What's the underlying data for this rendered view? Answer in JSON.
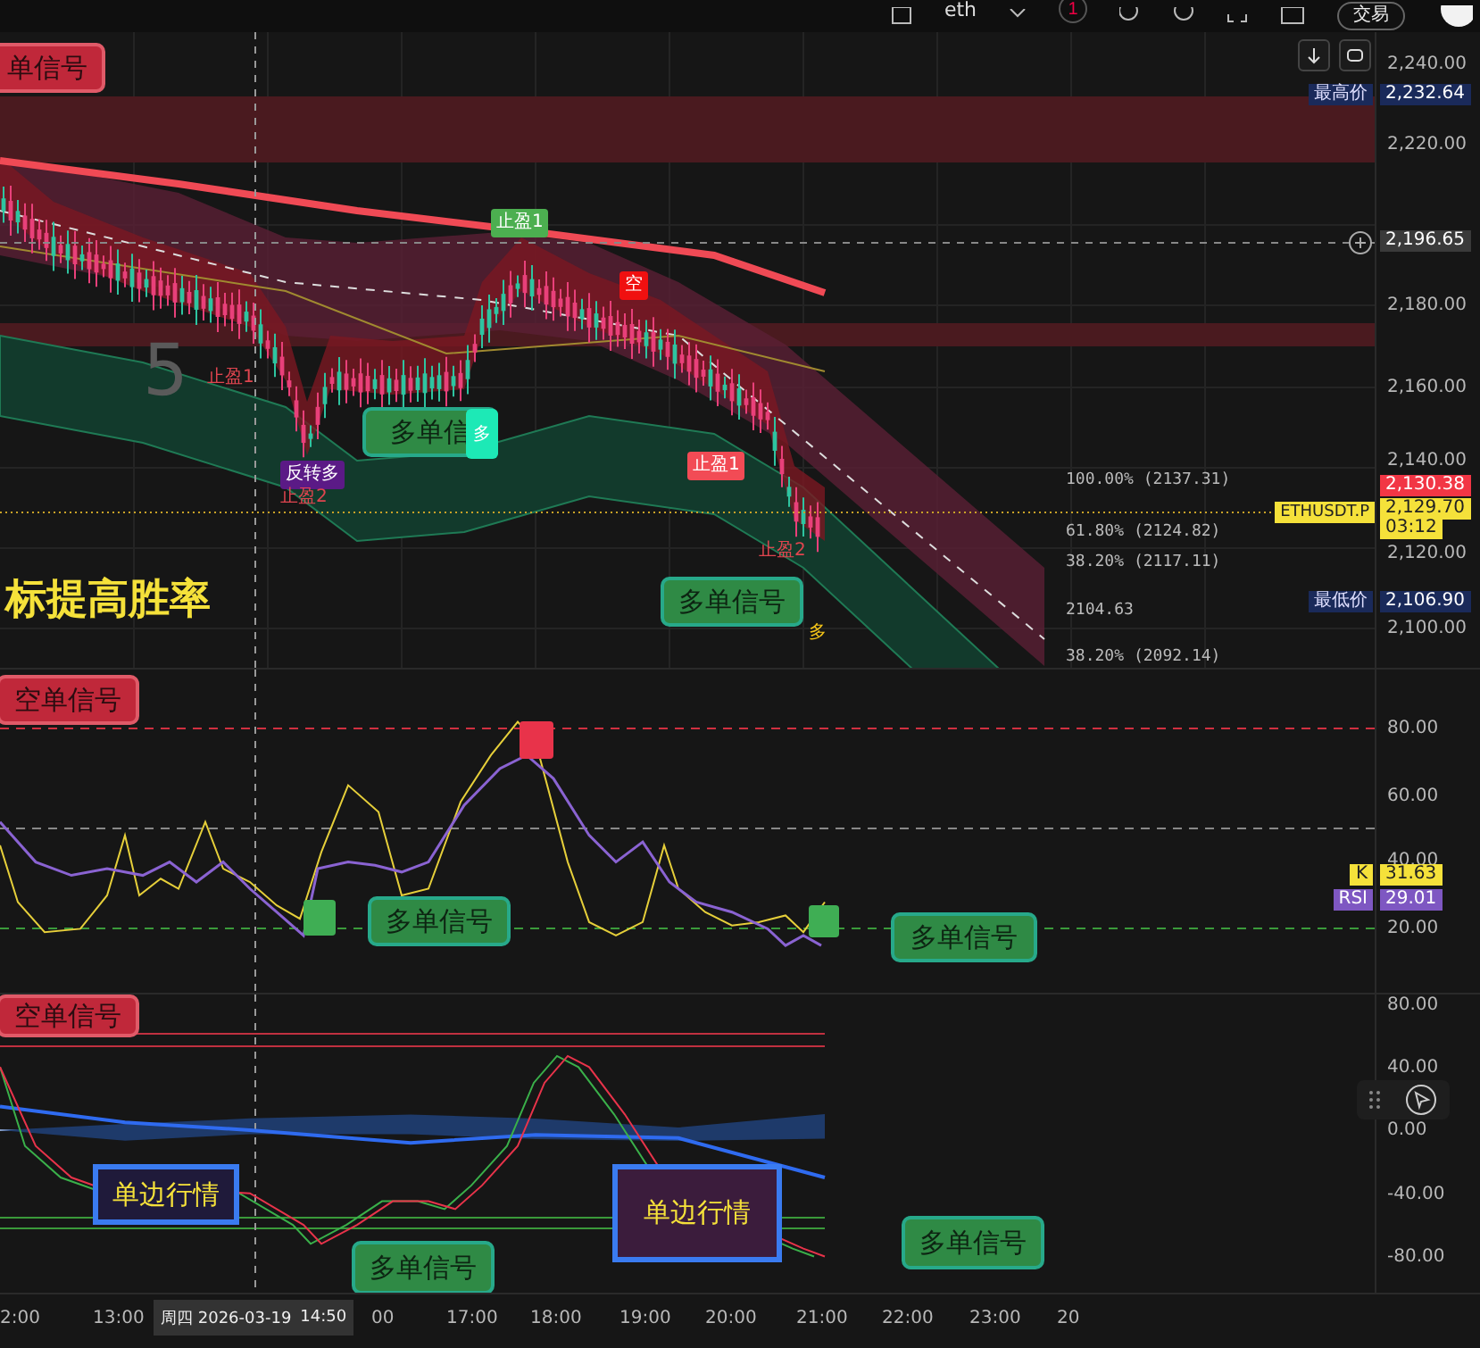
{
  "toolbar": {
    "symbol": "eth",
    "interval": "1",
    "trade_button": "交易"
  },
  "price_pane": {
    "callouts": [
      {
        "kind": "short",
        "text": "单信号"
      },
      {
        "kind": "long",
        "text": "多单信",
        "badge": "多"
      },
      {
        "kind": "long",
        "text": "多单信号"
      }
    ],
    "markers": [
      {
        "kind": "tp_long",
        "text": "止盈1"
      },
      {
        "kind": "short",
        "text": "空"
      },
      {
        "kind": "tp_short",
        "text": "止盈1"
      },
      {
        "kind": "reversal",
        "text": "反转多"
      },
      {
        "kind": "tp_text",
        "text": "止盈1"
      },
      {
        "kind": "tp_text",
        "text": "止盈2"
      },
      {
        "kind": "tp_text",
        "text": "止盈2"
      },
      {
        "kind": "long_text",
        "text": "多"
      }
    ],
    "overlay_text": "标提高胜率",
    "bar_count_digit": "5",
    "fib_levels": [
      {
        "percent": "100.00%",
        "price": "(2137.31)"
      },
      {
        "percent": "61.80%",
        "price": "(2124.82)"
      },
      {
        "percent": "38.20%",
        "price": "(2117.11)"
      },
      {
        "price": "2104.63"
      },
      {
        "percent": "38.20%",
        "price": "(2092.14)"
      }
    ],
    "price_ticks": [
      "2,240.00",
      "2,220.00",
      "2,180.00",
      "2,160.00",
      "2,140.00",
      "2,120.00",
      "2,100.00"
    ],
    "high": {
      "label": "最高价",
      "value": "2,232.64"
    },
    "crosshair_price": "2,196.65",
    "last_price": "2,130.38",
    "symbol_tag": "ETHUSDT.P",
    "mark_price": "2,129.70",
    "countdown": "03:12",
    "low": {
      "label": "最低价",
      "value": "2,106.90"
    }
  },
  "rsi_pane": {
    "callouts": [
      {
        "kind": "short",
        "text": "空单信号"
      },
      {
        "kind": "long",
        "text": "多单信号"
      },
      {
        "kind": "long",
        "text": "多单信号"
      }
    ],
    "ticks": [
      "80.00",
      "60.00",
      "40.00",
      "20.00"
    ],
    "legend": [
      {
        "label": "K",
        "value": "31.63",
        "color": "#f5e13a"
      },
      {
        "label": "RSI",
        "value": "29.01",
        "color": "#7e57c2"
      }
    ]
  },
  "macd_pane": {
    "callouts": [
      {
        "kind": "short",
        "text": "空单信号"
      },
      {
        "kind": "trend",
        "text": "单边行情"
      },
      {
        "kind": "trend_filled",
        "text": "单边行情"
      },
      {
        "kind": "long",
        "text": "多单信号"
      },
      {
        "kind": "long",
        "text": "多单信号"
      }
    ],
    "ticks": [
      "80.00",
      "40.00",
      "0.00",
      "-40.00",
      "-80.00"
    ]
  },
  "time_axis": {
    "labels": [
      "2:00",
      "13:00",
      "00",
      "17:00",
      "18:00",
      "19:00",
      "20:00",
      "21:00",
      "22:00",
      "23:00",
      "20"
    ],
    "crosshair_day": "周四 2026-03-19",
    "crosshair_time": "14:50"
  }
}
